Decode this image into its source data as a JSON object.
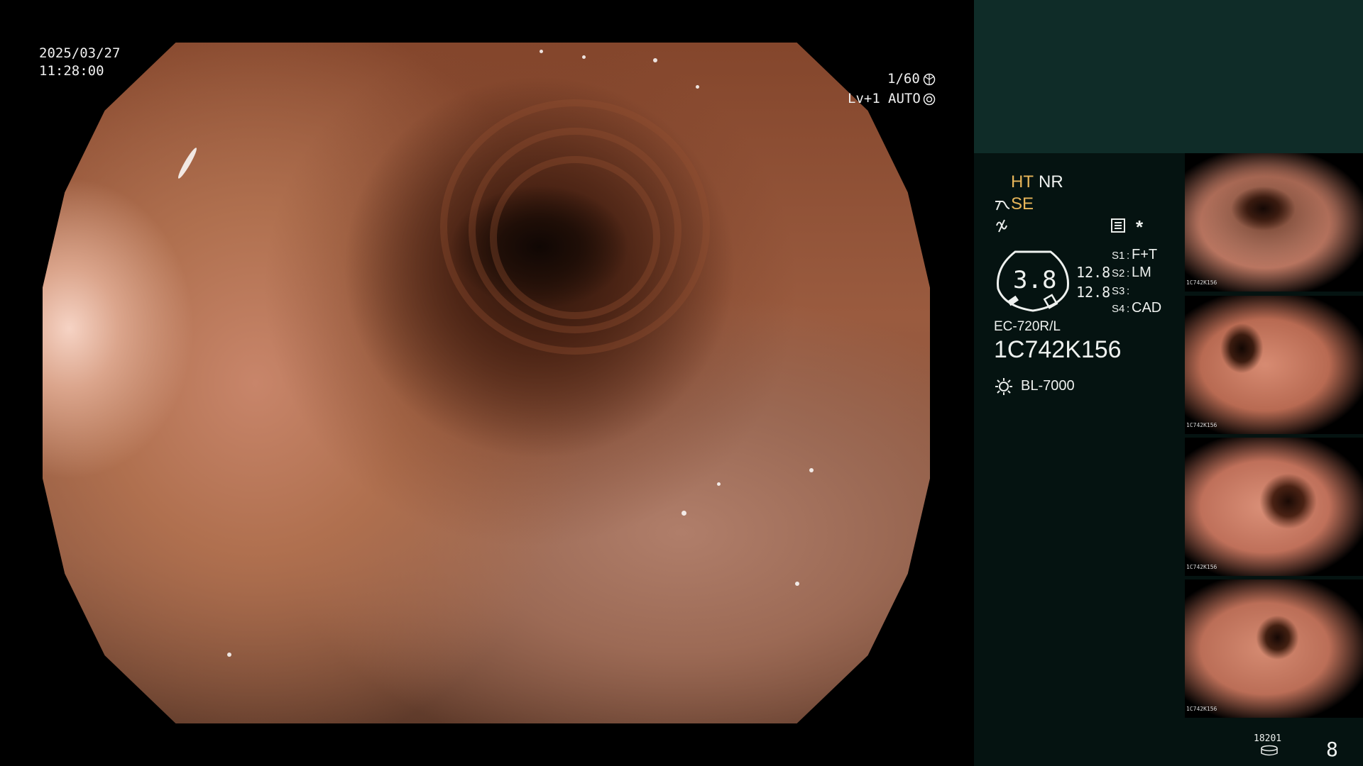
{
  "colors": {
    "accent_orange": "#e8b65a",
    "panel_bg": "#051311",
    "panel_top": "#0f2c28"
  },
  "osd": {
    "date": "2025/03/27",
    "time": "11:28:00",
    "shutter": "1/60",
    "level": "Lv+1",
    "iris": "AUTO"
  },
  "panel": {
    "ht": "HT",
    "nr": "NR",
    "se": "SE",
    "gauge_value": "3.8",
    "val_a": "12.8",
    "val_b": "12.8",
    "star": "*",
    "s1_key": "S1",
    "s1_val": "F+T",
    "s2_key": "S2",
    "s2_val": "LM",
    "s3_key": "S3",
    "s3_val": "",
    "s4_key": "S4",
    "s4_val": "CAD",
    "scope_model": "EC-720R/L",
    "scope_serial": "1C742K156",
    "light_source": "BL-7000",
    "storage_count": "18201",
    "capture_count": "8"
  },
  "thumbnails": [
    {
      "id": "thumb-1",
      "tag": "1C742K156"
    },
    {
      "id": "thumb-2",
      "tag": "1C742K156"
    },
    {
      "id": "thumb-3",
      "tag": "1C742K156"
    },
    {
      "id": "thumb-4",
      "tag": "1C742K156"
    }
  ]
}
